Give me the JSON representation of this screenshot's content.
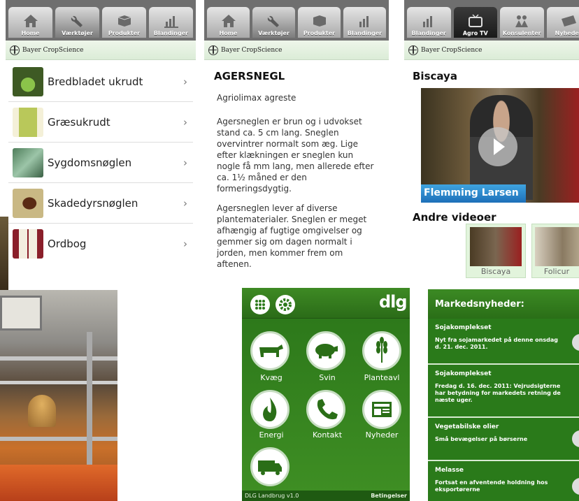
{
  "screen1": {
    "tabs": [
      {
        "label": "Home",
        "icon": "home-icon"
      },
      {
        "label": "Værktøjer",
        "icon": "wrench-icon"
      },
      {
        "label": "Produkter",
        "icon": "product-box-icon"
      },
      {
        "label": "Blandinger",
        "icon": "bar-chart-icon"
      }
    ],
    "brand": "Bayer CropScience",
    "items": [
      {
        "label": "Bredbladet ukrudt"
      },
      {
        "label": "Græsukrudt"
      },
      {
        "label": "Sygdomsnøglen"
      },
      {
        "label": "Skadedyrsnøglen"
      },
      {
        "label": "Ordbog"
      }
    ]
  },
  "screen2": {
    "tabs": [
      {
        "label": "Home",
        "icon": "home-icon"
      },
      {
        "label": "Værktøjer",
        "icon": "wrench-icon"
      },
      {
        "label": "Produkter",
        "icon": "product-box-icon"
      },
      {
        "label": "Blandinger",
        "icon": "bar-chart-icon"
      }
    ],
    "brand": "Bayer CropScience",
    "title": "AGERSNEGL",
    "latin": "Agriolimax agreste",
    "para1": "Agersneglen er brun og i udvokset stand ca. 5 cm lang. Sneglen overvintrer normalt som æg. Lige efter klækningen er sneglen kun nogle få mm lang, men allerede efter ca. 1½ måned er den formeringsdygtig.",
    "para2": "Agersneglen lever af diverse plantematerialer. Sneglen er meget afhængig af fugtige omgivelser og gemmer sig om dagen normalt i jorden, men kommer frem om aftenen."
  },
  "screen3": {
    "tabs": [
      {
        "label": "Blandinger",
        "icon": "bar-chart-icon"
      },
      {
        "label": "Agro TV",
        "icon": "tv-icon"
      },
      {
        "label": "Konsulenter",
        "icon": "people-icon"
      },
      {
        "label": "Nyheder",
        "icon": "newspaper-icon"
      }
    ],
    "brand": "Bayer CropScience",
    "title": "Biscaya",
    "video_caption": "Flemming Larsen",
    "other_heading": "Andre videoer",
    "other_videos": [
      {
        "label": "Biscaya"
      },
      {
        "label": "Folicur"
      }
    ]
  },
  "screen4": {
    "logo": "dlg",
    "icons": [
      {
        "label": "Kvæg",
        "icon": "cow-icon"
      },
      {
        "label": "Svin",
        "icon": "pig-icon"
      },
      {
        "label": "Planteavl",
        "icon": "wheat-icon"
      },
      {
        "label": "Energi",
        "icon": "flame-icon"
      },
      {
        "label": "Kontakt",
        "icon": "phone-icon"
      },
      {
        "label": "Nyheder",
        "icon": "newspaper-icon"
      },
      {
        "label": "",
        "icon": "truck-icon"
      }
    ],
    "footer_left": "DLG Landbrug v1.0",
    "footer_right": "Betingelser"
  },
  "screen5": {
    "heading": "Markedsnyheder:",
    "items": [
      {
        "title": "Sojakomplekset",
        "body": "Nyt fra sojamarkedet på denne onsdag d. 21. dec. 2011."
      },
      {
        "title": "Sojakomplekset",
        "body": "Fredag d. 16. dec. 2011: Vejrudsigterne har betydning for markedets retning de næste uger."
      },
      {
        "title": "Vegetabilske olier",
        "body": "Små bevægelser på børserne"
      },
      {
        "title": "Melasse",
        "body": "Fortsat en afventende holdning hos eksportørerne"
      }
    ]
  }
}
